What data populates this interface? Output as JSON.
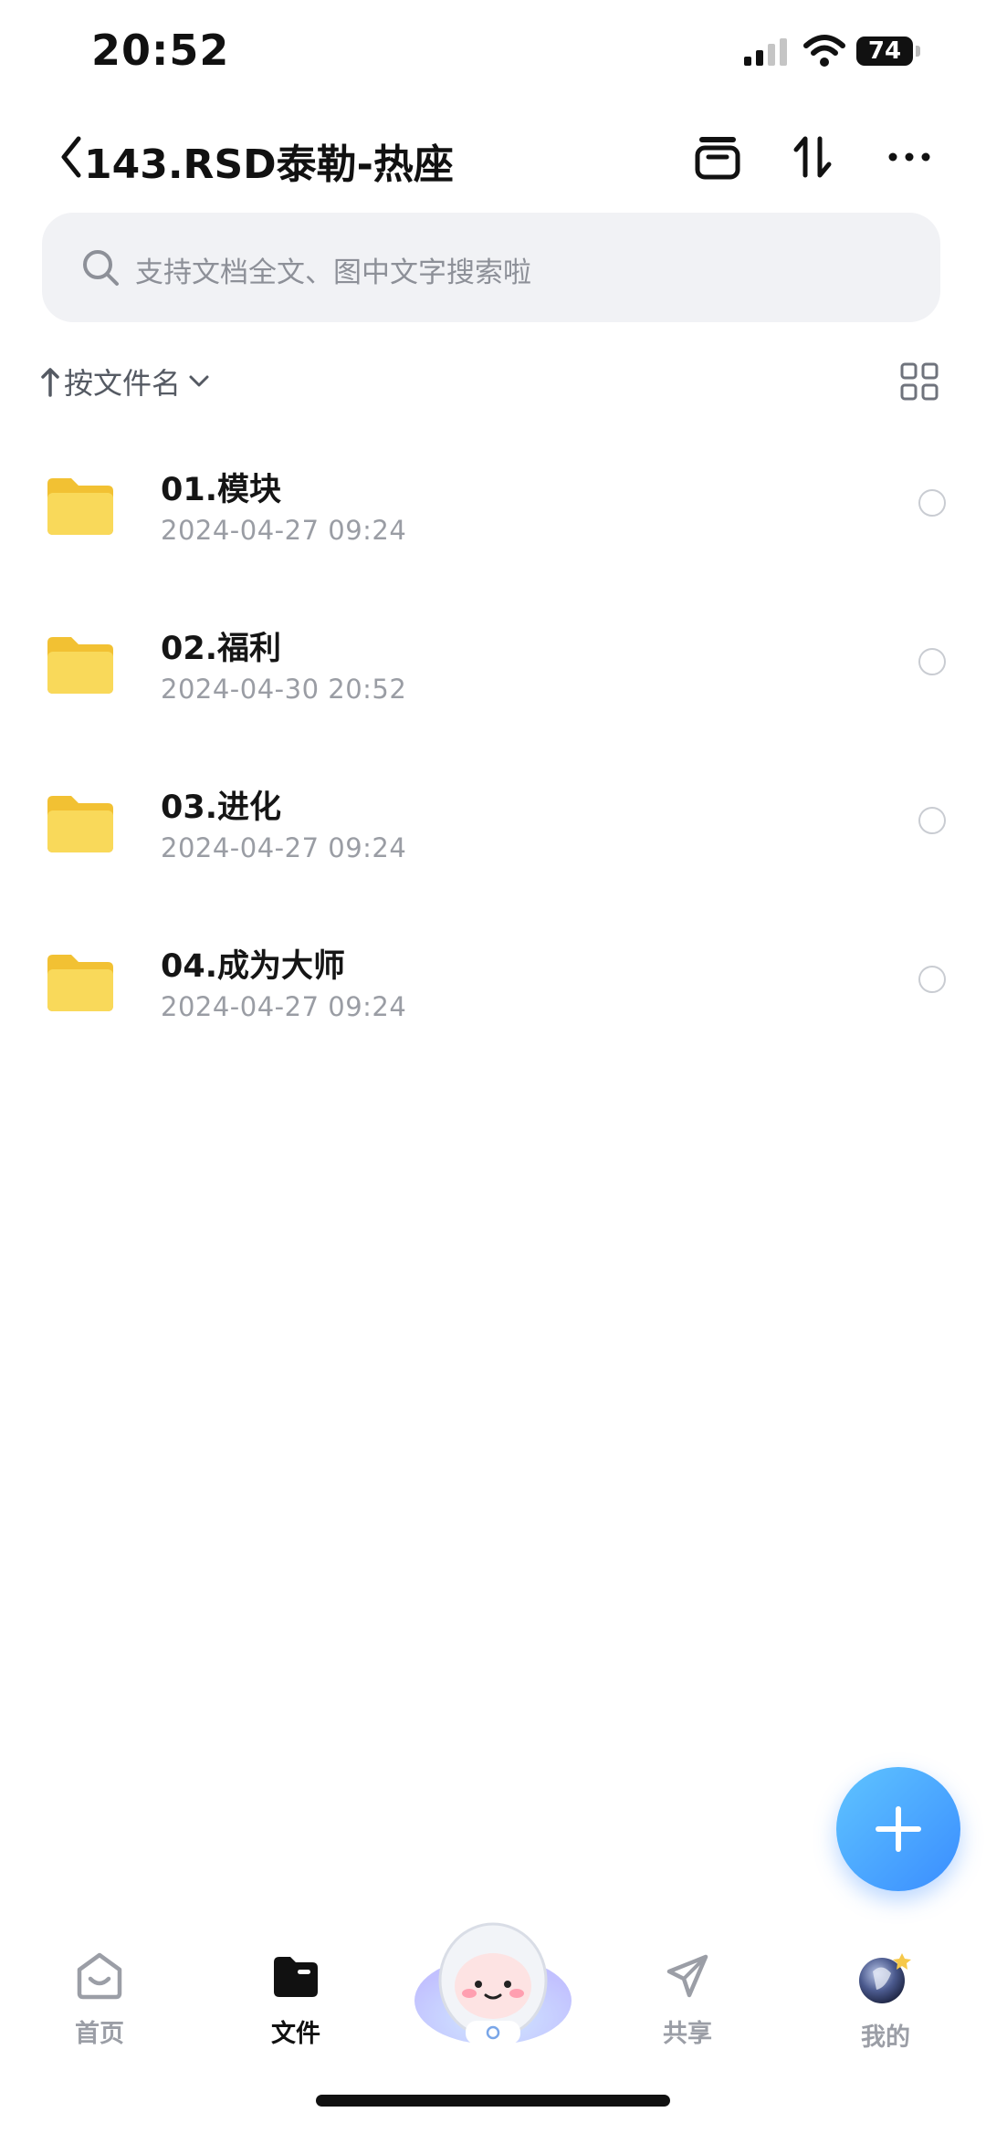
{
  "status_bar": {
    "time": "20:52",
    "battery": "74"
  },
  "header": {
    "title": "143.RSD泰勒-热座"
  },
  "search": {
    "placeholder": "支持文档全文、图中文字搜索啦"
  },
  "sort": {
    "label": "按文件名"
  },
  "files": [
    {
      "name": "01.模块",
      "date": "2024-04-27 09:24"
    },
    {
      "name": "02.福利",
      "date": "2024-04-30 20:52"
    },
    {
      "name": "03.进化",
      "date": "2024-04-27 09:24"
    },
    {
      "name": "04.成为大师",
      "date": "2024-04-27 09:24"
    }
  ],
  "tabbar": {
    "home": "首页",
    "files": "文件",
    "share": "共享",
    "mine": "我的"
  },
  "colors": {
    "accent": "#3a8dff",
    "folder": "#f7cf45",
    "search_bg": "#f1f2f5"
  }
}
